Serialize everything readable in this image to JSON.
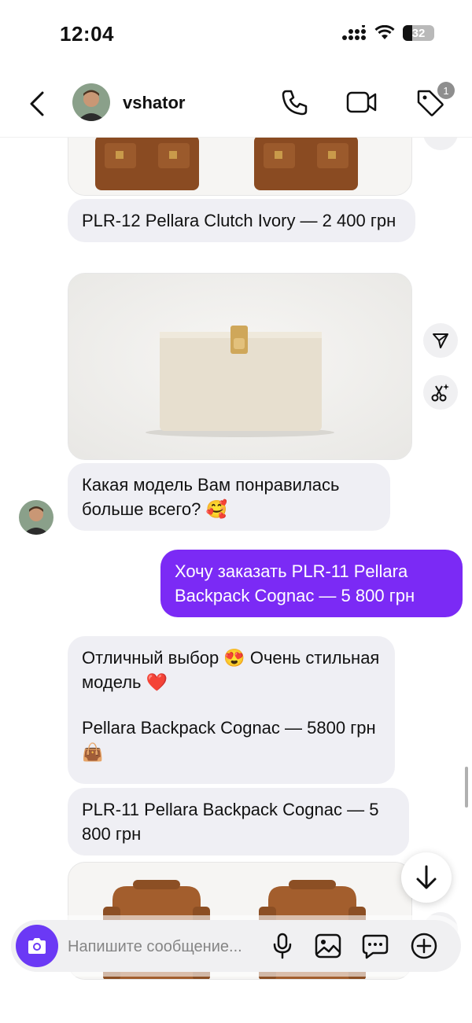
{
  "status": {
    "time": "12:04",
    "battery": "32"
  },
  "header": {
    "username": "vshator",
    "badge_count": "1"
  },
  "messages": {
    "m1": "PLR-12 Pellara Clutch Ivory — 2 400 грн",
    "m2": "Какая модель Вам понравилась больше всего? 🥰",
    "m3": "Хочу заказать PLR-11 Pellara Backpack Cognac — 5 800 грн",
    "m4_line1": "Отличный выбор 😍 Очень стильная модель ❤️",
    "m4_line2": "Pellara Backpack Cognac — 5800 грн 👜",
    "m5": "PLR-11 Pellara Backpack Cognac — 5 800 грн"
  },
  "composer": {
    "placeholder": "Напишите сообщение..."
  },
  "icons": [
    "back-icon",
    "phone-icon",
    "video-icon",
    "tag-icon",
    "send-icon",
    "magic-cut-icon",
    "arrow-down-icon",
    "camera-icon",
    "mic-icon",
    "gallery-icon",
    "sticker-icon",
    "add-icon"
  ],
  "colors": {
    "outgoing_bubble": "#7b2af5",
    "incoming_bubble": "#efeff4",
    "camera_button": "#6b39f5"
  }
}
